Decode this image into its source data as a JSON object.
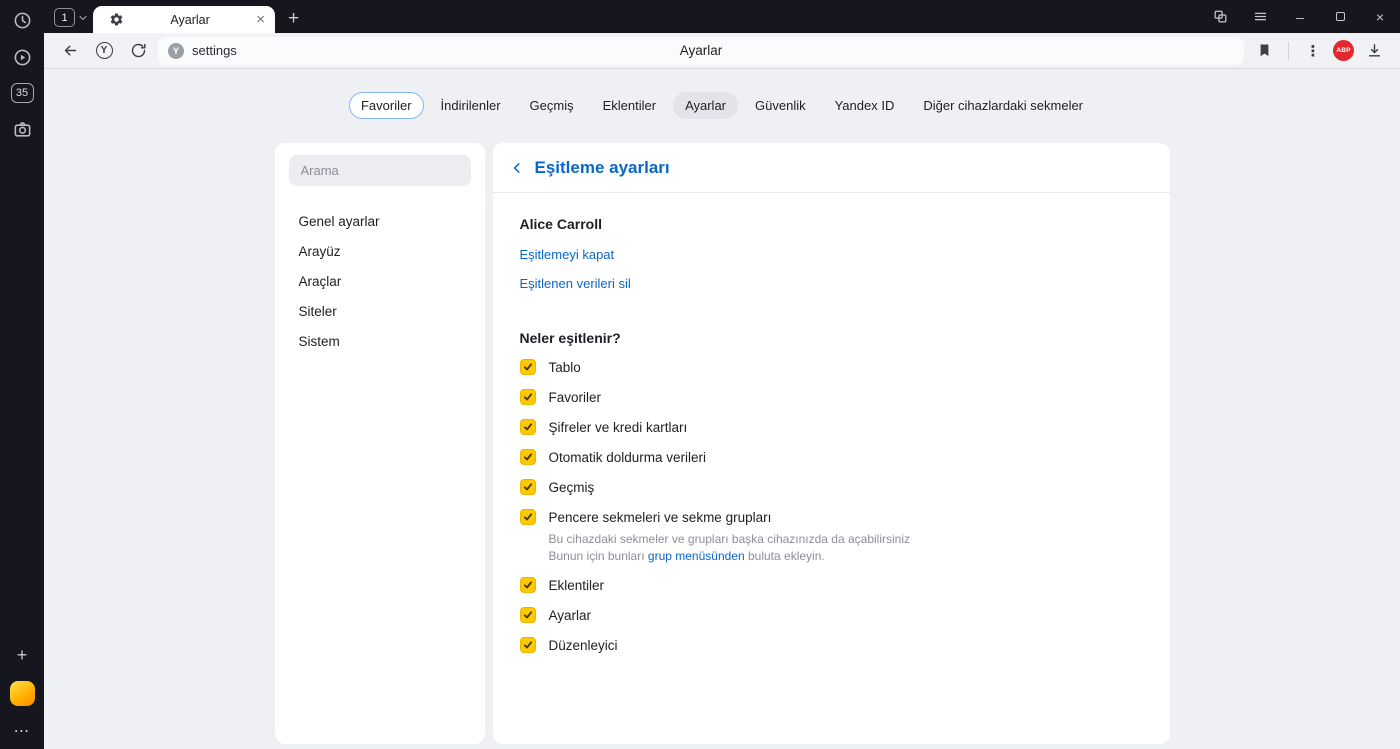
{
  "colors": {
    "accent_blue": "#0a67c9",
    "checkbox_yellow": "#ffc800",
    "abp_red": "#e3282f",
    "chrome_dark": "#16161f"
  },
  "glyphs": {
    "plus": "+",
    "close": "×",
    "minimize": "–",
    "more_vertical": "⋮",
    "more_horizontal": "⋯",
    "y_letter": "Y"
  },
  "rail": {
    "tab_badge": "35"
  },
  "browser": {
    "tab_count": "1",
    "tab_title": "Ayarlar",
    "address": "settings",
    "omnibox_title": "Ayarlar",
    "abp_badge": "ABP"
  },
  "top_tabs": [
    {
      "label": "Favoriler"
    },
    {
      "label": "İndirilenler"
    },
    {
      "label": "Geçmiş"
    },
    {
      "label": "Eklentiler"
    },
    {
      "label": "Ayarlar"
    },
    {
      "label": "Güvenlik"
    },
    {
      "label": "Yandex ID"
    },
    {
      "label": "Diğer cihazlardaki sekmeler"
    }
  ],
  "sidebar": {
    "search_placeholder": "Arama",
    "items": [
      {
        "label": "Genel ayarlar"
      },
      {
        "label": "Arayüz"
      },
      {
        "label": "Araçlar"
      },
      {
        "label": "Siteler"
      },
      {
        "label": "Sistem"
      }
    ]
  },
  "panel": {
    "title": "Eşitleme ayarları",
    "account_name": "Alice Carroll",
    "link_disable_sync": "Eşitlemeyi kapat",
    "link_delete_synced": "Eşitlenen verileri sil",
    "section_title": "Neler eşitlenir?",
    "options": [
      {
        "label": "Tablo",
        "checked": true
      },
      {
        "label": "Favoriler",
        "checked": true
      },
      {
        "label": "Şifreler ve kredi kartları",
        "checked": true
      },
      {
        "label": "Otomatik doldurma verileri",
        "checked": true
      },
      {
        "label": "Geçmiş",
        "checked": true
      },
      {
        "label": "Pencere sekmeleri ve sekme grupları",
        "checked": true,
        "desc_line1": "Bu cihazdaki sekmeler ve grupları başka cihazınızda da açabilirsiniz",
        "desc_line2_before": "Bunun için bunları ",
        "desc_link": "grup menüsünden",
        "desc_line2_after": " buluta ekleyin."
      },
      {
        "label": "Eklentiler",
        "checked": true
      },
      {
        "label": "Ayarlar",
        "checked": true
      },
      {
        "label": "Düzenleyici",
        "checked": true
      }
    ]
  }
}
